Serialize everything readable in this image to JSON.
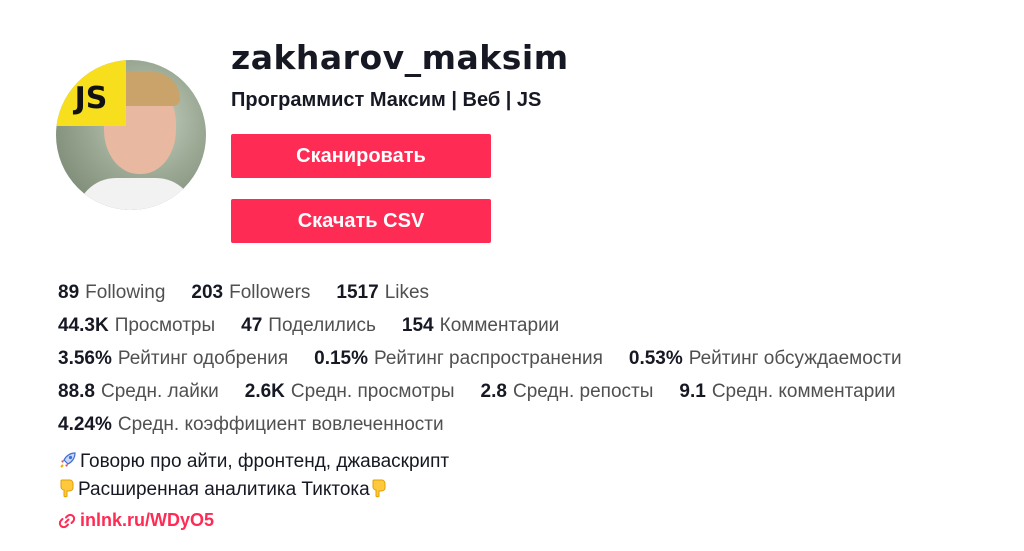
{
  "profile": {
    "username": "zakharov_maksim",
    "nickname": "Программист Максим | Веб | JS",
    "avatar_badge": "JS"
  },
  "actions": {
    "scan_label": "Сканировать",
    "download_csv_label": "Скачать CSV"
  },
  "stats_rows": [
    [
      {
        "num": "89",
        "label": "Following"
      },
      {
        "num": "203",
        "label": "Followers"
      },
      {
        "num": "1517",
        "label": "Likes"
      }
    ],
    [
      {
        "num": "44.3K",
        "label": "Просмотры"
      },
      {
        "num": "47",
        "label": "Поделились"
      },
      {
        "num": "154",
        "label": "Комментарии"
      }
    ],
    [
      {
        "num": "3.56%",
        "label": "Рейтинг одобрения"
      },
      {
        "num": "0.15%",
        "label": "Рейтинг распространения"
      },
      {
        "num": "0.53%",
        "label": "Рейтинг обсуждаемости"
      }
    ],
    [
      {
        "num": "88.8",
        "label": "Средн. лайки"
      },
      {
        "num": "2.6K",
        "label": "Средн. просмотры"
      },
      {
        "num": "2.8",
        "label": "Средн. репосты"
      },
      {
        "num": "9.1",
        "label": "Средн. комментарии"
      }
    ],
    [
      {
        "num": "4.24%",
        "label": "Средн. коэффициент вовлеченности"
      }
    ]
  ],
  "bio": {
    "line1": "Говорю про айти, фронтенд, джаваскрипт",
    "line1_icon": "rocket-icon",
    "line2": "Расширенная аналитика Тиктока",
    "line2_icon": "pointing-down-icon"
  },
  "link": {
    "text": "inlnk.ru/WDyO5",
    "icon": "link-icon"
  },
  "colors": {
    "accent": "#fe2c55",
    "badge": "#f7df1e",
    "text": "#161823",
    "muted": "#505050"
  }
}
